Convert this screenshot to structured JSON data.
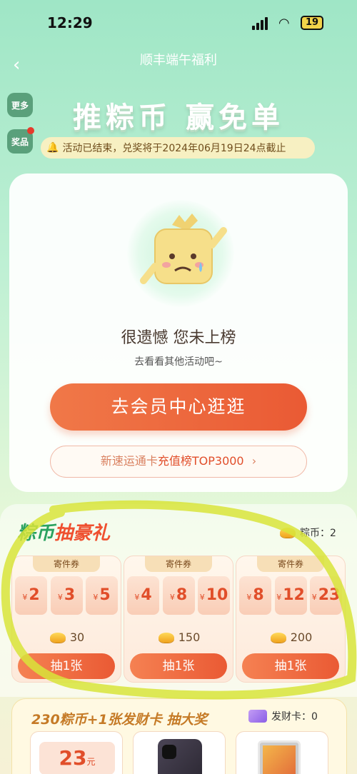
{
  "status_bar": {
    "time": "12:29",
    "battery": "19"
  },
  "nav": {
    "title": "顺丰端午福利"
  },
  "side_buttons": {
    "more": "更多",
    "prizes": "奖品"
  },
  "hero": {
    "title": "推粽币 赢免单",
    "notice": "活动已结束，兑奖将于2024年06月19日24点截止"
  },
  "result_card": {
    "sorry_text": "很遗憾 您未上榜",
    "sub_text": "去看看其他活动吧~",
    "main_button": "去会员中心逛逛",
    "rank_prefix": "新速运通卡",
    "rank_highlight": "充值榜TOP3000",
    "rank_arrow": "›"
  },
  "lottery": {
    "title_part1": "粽币",
    "title_part2": "抽豪礼",
    "coin_balance_label": "粽币：2",
    "packages": [
      {
        "label": "寄件券",
        "values": [
          "2",
          "3",
          "5"
        ],
        "currency": "¥",
        "cost": "30",
        "button": "抽1张"
      },
      {
        "label": "寄件券",
        "values": [
          "4",
          "8",
          "10"
        ],
        "currency": "¥",
        "cost": "150",
        "button": "抽1张"
      },
      {
        "label": "寄件券",
        "values": [
          "8",
          "12",
          "23"
        ],
        "currency": "¥",
        "cost": "200",
        "button": "抽1张"
      }
    ]
  },
  "big_prize": {
    "title": "230粽币+1张发财卡 抽大奖",
    "fortune_card_label": "发财卡：0",
    "coupon_value": "23",
    "coupon_unit": "元"
  },
  "colors": {
    "accent_orange": "#ea5a34",
    "accent_green": "#29a25f",
    "highlighter": "#d8e43a"
  }
}
